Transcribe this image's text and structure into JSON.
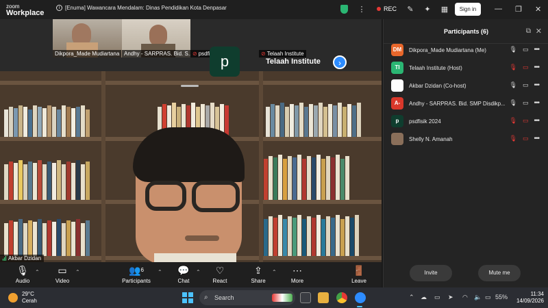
{
  "titlebar": {
    "brand_top": "zoom",
    "brand_bottom": "Workplace",
    "meeting_title": "[Enuma] Wawancara Mendalam: Dinas Pendidikan Kota Denpasar",
    "rec_label": "REC",
    "signin_label": "Sign in"
  },
  "strip": {
    "thumbnails": [
      {
        "name": "Dikpora_Made Mudiartana"
      },
      {
        "name": "Andhy - SARPRAS. Bid. S..."
      },
      {
        "name": "psdfisik 2024",
        "avatar_letter": "p"
      },
      {
        "name": "Telaah Institute",
        "title": "Telaah Institute"
      }
    ]
  },
  "stage": {
    "active_speaker": "Akbar Dzidan"
  },
  "controls": {
    "audio": "Audio",
    "video": "Video",
    "participants": "Participants",
    "participants_count": "6",
    "chat": "Chat",
    "react": "React",
    "share": "Share",
    "more": "More",
    "leave": "Leave"
  },
  "panel": {
    "title": "Participants (6)",
    "participants": [
      {
        "initials": "DM",
        "name": "Dikpora_Made Mudiartana (Me)",
        "color": "#e8672b",
        "mic": "on",
        "cam": "on"
      },
      {
        "initials": "TI",
        "name": "Telaah Institute (Host)",
        "color": "#2bb673",
        "mic": "muted",
        "cam": "off"
      },
      {
        "initials": "",
        "name": "Akbar Dzidan (Co-host)",
        "color": "#ffffff",
        "mic": "on",
        "cam": "on"
      },
      {
        "initials": "A-",
        "name": "Andhy - SARPRAS. Bid. SMP Disdikp...",
        "color": "#d9382b",
        "mic": "on",
        "cam": "on"
      },
      {
        "initials": "p",
        "name": "psdfisik 2024",
        "color": "#0f3d2e",
        "mic": "muted",
        "cam": "off"
      },
      {
        "initials": "",
        "name": "Shelly N. Amanah",
        "color": "#8a6f5a",
        "mic": "muted",
        "cam": "off"
      }
    ],
    "invite_label": "Invite",
    "mute_me_label": "Mute me"
  },
  "taskbar": {
    "temp": "29°C",
    "condition": "Cerah",
    "search_placeholder": "Search",
    "battery": "55%",
    "time": "11:34",
    "date": "14/09/2026"
  }
}
